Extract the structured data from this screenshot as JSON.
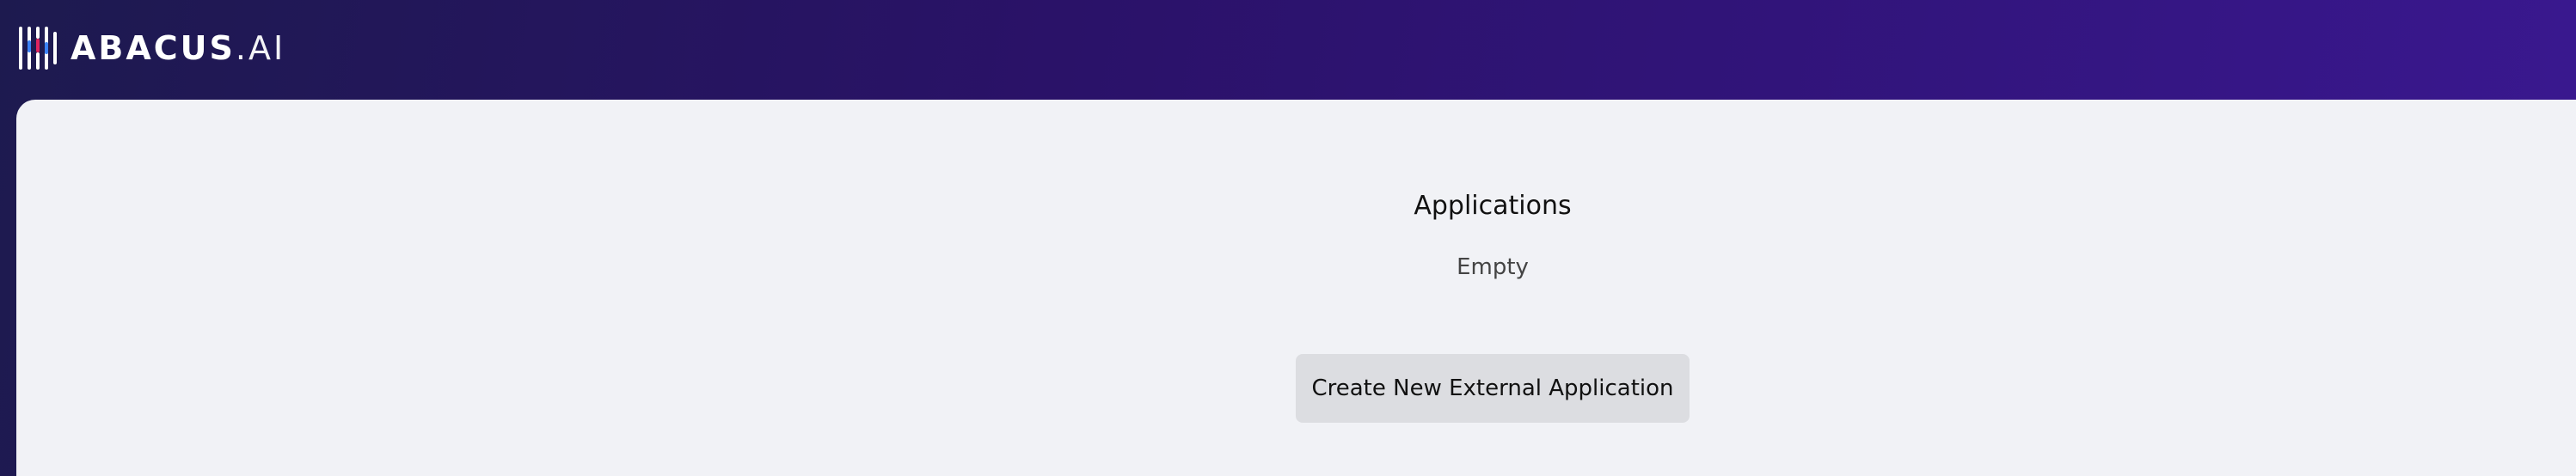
{
  "header": {
    "logo": {
      "brand_primary": "ABACUS",
      "brand_suffix": ".AI",
      "icon": "abacus-logo-icon"
    }
  },
  "main": {
    "title": "Applications",
    "empty_text": "Empty",
    "create_button_label": "Create New External Application"
  },
  "colors": {
    "header_gradient_start": "#1d1a4f",
    "header_gradient_end": "#3a1890",
    "content_background": "#f1f2f6",
    "button_background": "#dcdde1",
    "logo_accent_red": "#e0245e",
    "logo_accent_blue": "#3b82f6"
  }
}
